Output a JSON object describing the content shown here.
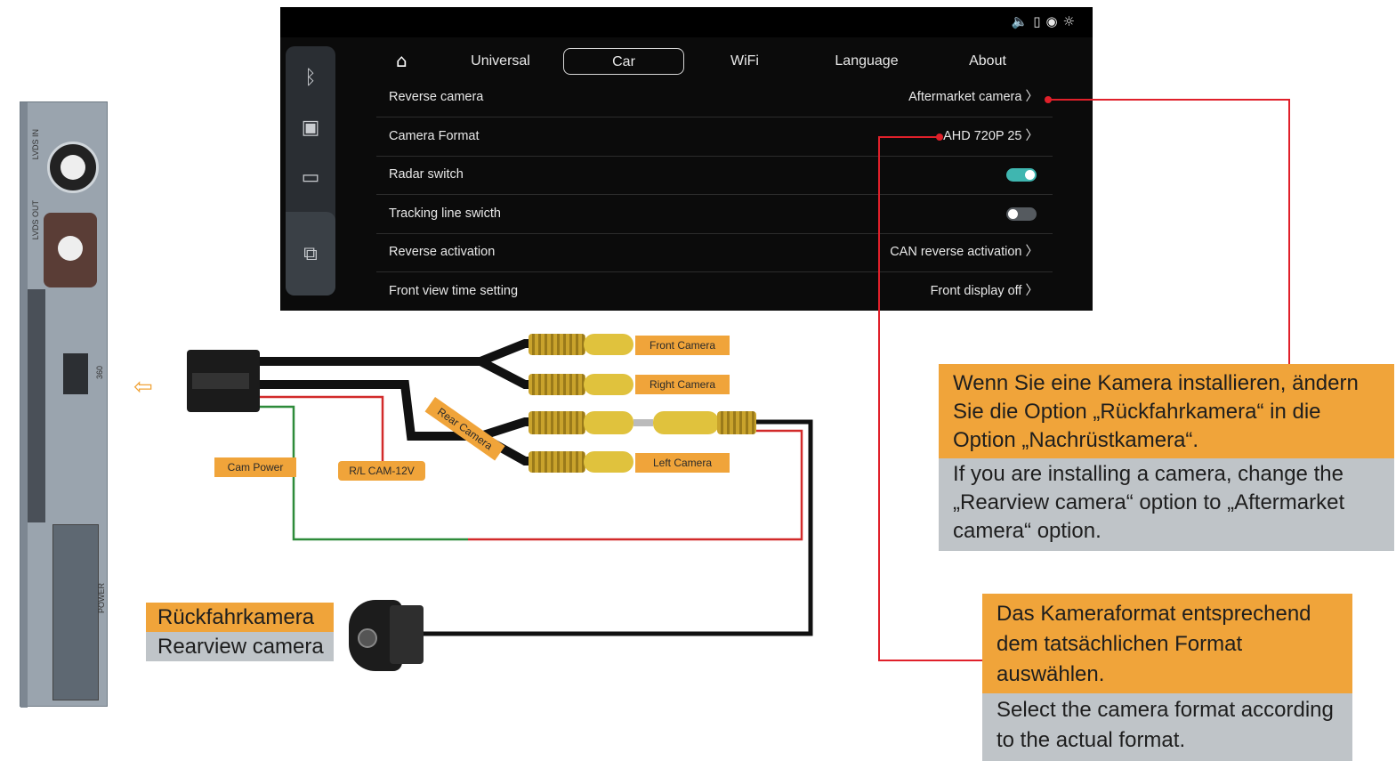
{
  "screen": {
    "tabs": [
      {
        "label": "Universal"
      },
      {
        "label": "Car"
      },
      {
        "label": "WiFi"
      },
      {
        "label": "Language"
      },
      {
        "label": "About"
      }
    ],
    "rows": [
      {
        "label": "Reverse camera",
        "value": "Aftermarket camera"
      },
      {
        "label": "Camera Format",
        "value": "AHD 720P 25"
      },
      {
        "label": "Radar switch",
        "toggle_on": true
      },
      {
        "label": "Tracking line swicth",
        "toggle_on": false
      },
      {
        "label": "Reverse activation",
        "value": "CAN reverse activation"
      },
      {
        "label": "Front view time setting",
        "value": "Front display off"
      }
    ],
    "accent_color": "#3fb6b0",
    "sidebar_icons": [
      "bluetooth-icon",
      "media-icon",
      "screen-icon",
      "carplay-icon"
    ],
    "status_icons": [
      "volume-icon",
      "phone-icon",
      "hotspot-icon",
      "brightness-icon"
    ]
  },
  "device": {
    "labels": [
      "LVDS IN",
      "LVDS OUT",
      "360",
      "POWER"
    ]
  },
  "harness": {
    "front_camera": "Front Camera",
    "right_camera": "Right Camera",
    "rear_camera": "Rear Camera",
    "left_camera": "Left Camera",
    "cam_power": "Cam Power",
    "rl_cam": "R/L CAM-12V"
  },
  "rearview": {
    "de": "Rückfahrkamera",
    "en": "Rearview camera"
  },
  "note1": {
    "de": "Wenn Sie eine Kamera installieren, ändern Sie die Option „Rückfahrkamera“ in die Option „Nachrüstkamera“.",
    "en": "If you are installing a camera, change the „Rearview camera“ option to „Aftermarket camera“ option."
  },
  "note2": {
    "de": "Das Kameraformat entsprechend dem tatsächlichen Format auswählen.",
    "en": "Select the camera format according to the actual format."
  },
  "colors": {
    "orange": "#f0a43a",
    "gray": "#bfc4c8",
    "callout_line": "#e0202a"
  }
}
